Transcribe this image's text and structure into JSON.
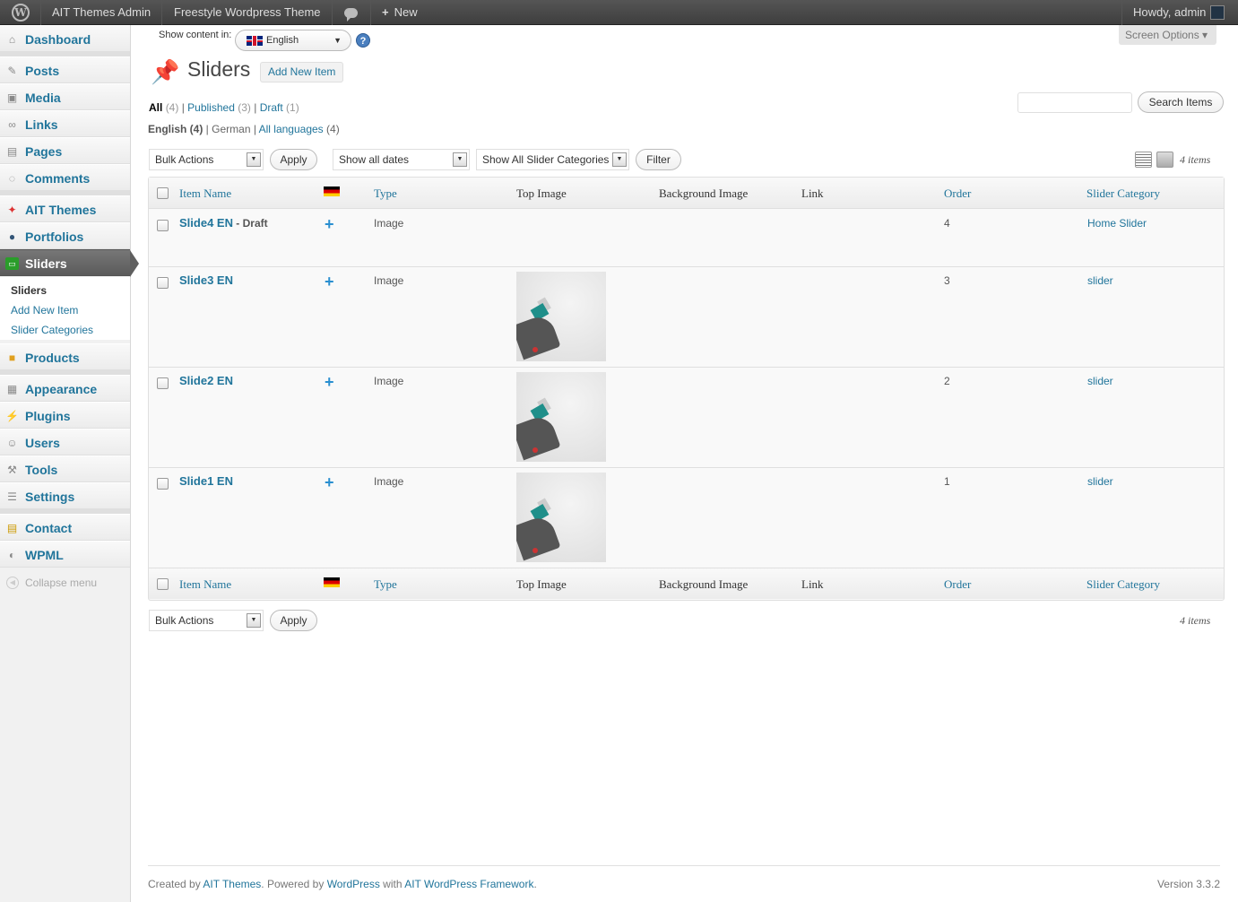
{
  "adminbar": {
    "site_admin": "AIT Themes Admin",
    "theme": "Freestyle Wordpress Theme",
    "new": "New",
    "howdy": "Howdy, admin"
  },
  "sidebar": {
    "items": [
      {
        "label": "Dashboard",
        "icon": "home-icon"
      },
      {
        "label": "Posts",
        "icon": "pushpin-icon"
      },
      {
        "label": "Media",
        "icon": "media-icon"
      },
      {
        "label": "Links",
        "icon": "links-icon"
      },
      {
        "label": "Pages",
        "icon": "pages-icon"
      },
      {
        "label": "Comments",
        "icon": "comments-icon"
      },
      {
        "label": "AIT Themes",
        "icon": "ait-themes-icon"
      },
      {
        "label": "Portfolios",
        "icon": "portfolios-icon"
      },
      {
        "label": "Sliders",
        "icon": "sliders-icon"
      },
      {
        "label": "Products",
        "icon": "products-icon"
      },
      {
        "label": "Appearance",
        "icon": "appearance-icon"
      },
      {
        "label": "Plugins",
        "icon": "plugins-icon"
      },
      {
        "label": "Users",
        "icon": "users-icon"
      },
      {
        "label": "Tools",
        "icon": "tools-icon"
      },
      {
        "label": "Settings",
        "icon": "settings-icon"
      },
      {
        "label": "Contact",
        "icon": "contact-icon"
      },
      {
        "label": "WPML",
        "icon": "wpml-icon"
      }
    ],
    "submenu": [
      "Sliders",
      "Add New Item",
      "Slider Categories"
    ],
    "collapse": "Collapse menu"
  },
  "lang": {
    "show_content_in": "Show content in:",
    "selected": "English"
  },
  "screen_options": "Screen Options ▾",
  "page": {
    "title": "Sliders",
    "add_new": "Add New Item"
  },
  "status_filter": {
    "all": "All",
    "all_count": "(4)",
    "published": "Published",
    "published_count": "(3)",
    "draft": "Draft",
    "draft_count": "(1)"
  },
  "lang_filter": {
    "english": "English (4)",
    "german": "German",
    "all": "All languages",
    "all_count": "(4)"
  },
  "search_button": "Search Items",
  "bulk_actions": "Bulk Actions",
  "apply": "Apply",
  "dates_select": "Show all dates",
  "categories_select": "Show All Slider Categories",
  "filter": "Filter",
  "items_count": "4 items",
  "table": {
    "columns": [
      "Item Name",
      "Type",
      "Top Image",
      "Background Image",
      "Link",
      "Order",
      "Slider Category"
    ],
    "rows": [
      {
        "title": "Slide4 EN",
        "state": " - Draft",
        "type": "Image",
        "has_image": false,
        "order": "4",
        "category": "Home Slider"
      },
      {
        "title": "Slide3 EN",
        "state": "",
        "type": "Image",
        "has_image": true,
        "order": "3",
        "category": "slider"
      },
      {
        "title": "Slide2 EN",
        "state": "",
        "type": "Image",
        "has_image": true,
        "order": "2",
        "category": "slider"
      },
      {
        "title": "Slide1 EN",
        "state": "",
        "type": "Image",
        "has_image": true,
        "order": "1",
        "category": "slider"
      }
    ]
  },
  "footer": {
    "created_by": "Created by",
    "ait": "AIT Themes",
    "powered": ". Powered by",
    "wordpress": "WordPress",
    "with": "with",
    "framework": "AIT WordPress Framework",
    "end": ".",
    "version": "Version 3.3.2"
  }
}
